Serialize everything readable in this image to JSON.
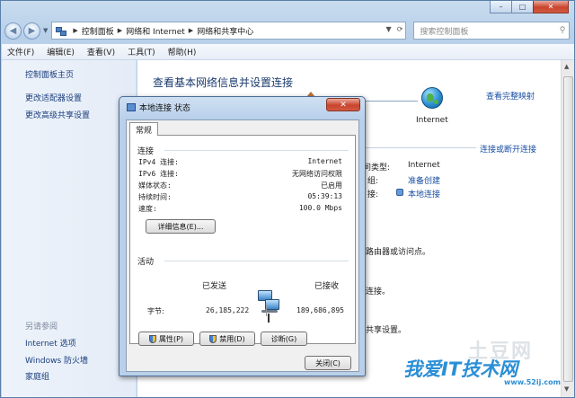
{
  "window": {
    "caption_buttons": {
      "minimize": "–",
      "maximize": "□",
      "close": "✕"
    }
  },
  "nav": {
    "back_icon": "◀",
    "forward_icon": "▶",
    "breadcrumbs": [
      "控制面板",
      "网络和 Internet",
      "网络和共享中心"
    ],
    "search_placeholder": "搜索控制面板"
  },
  "menu": [
    "文件(F)",
    "编辑(E)",
    "查看(V)",
    "工具(T)",
    "帮助(H)"
  ],
  "sidebar": {
    "links": [
      "控制面板主页",
      "更改适配器设置",
      "更改高级共享设置"
    ],
    "see_also_title": "另请参阅",
    "see_also": [
      "Internet 选项",
      "Windows 防火墙",
      "家庭组"
    ]
  },
  "main": {
    "title": "查看基本网络信息并设置连接",
    "see_full_map": "查看完整映射",
    "internet_label": "Internet",
    "connect_disconnect": "连接或断开连接",
    "access_type_key": "问类型:",
    "access_type_val": "Internet",
    "homegroup_key": "组:",
    "homegroup_val": "准备创建",
    "connection_key": "接:",
    "connection_val": "本地连接",
    "row_text_1": "路由器或访问点。",
    "row_text_2": "连接。",
    "row_text_3": "共享设置。"
  },
  "dialog": {
    "title": "本地连接 状态",
    "close": "✕",
    "tab": "常规",
    "connection_group": "连接",
    "rows": [
      {
        "key": "IPv4 连接:",
        "value": "Internet"
      },
      {
        "key": "IPv6 连接:",
        "value": "无网络访问权限"
      },
      {
        "key": "媒体状态:",
        "value": "已启用"
      },
      {
        "key": "持续时间:",
        "value": "05:39:13"
      },
      {
        "key": "速度:",
        "value": "100.0 Mbps"
      }
    ],
    "details_button": "详细信息(E)...",
    "activity_group": "活动",
    "sent_label": "已发送",
    "received_label": "已接收",
    "bytes_label": "字节:",
    "bytes_sent": "26,185,222",
    "bytes_received": "189,686,895",
    "properties_button": "属性(P)",
    "disable_button": "禁用(D)",
    "diagnose_button": "诊断(G)",
    "close_button": "关闭(C)"
  },
  "watermark": {
    "faint": "土豆网",
    "brand": "我爱IT技术网",
    "url": "www.52ij.com"
  }
}
